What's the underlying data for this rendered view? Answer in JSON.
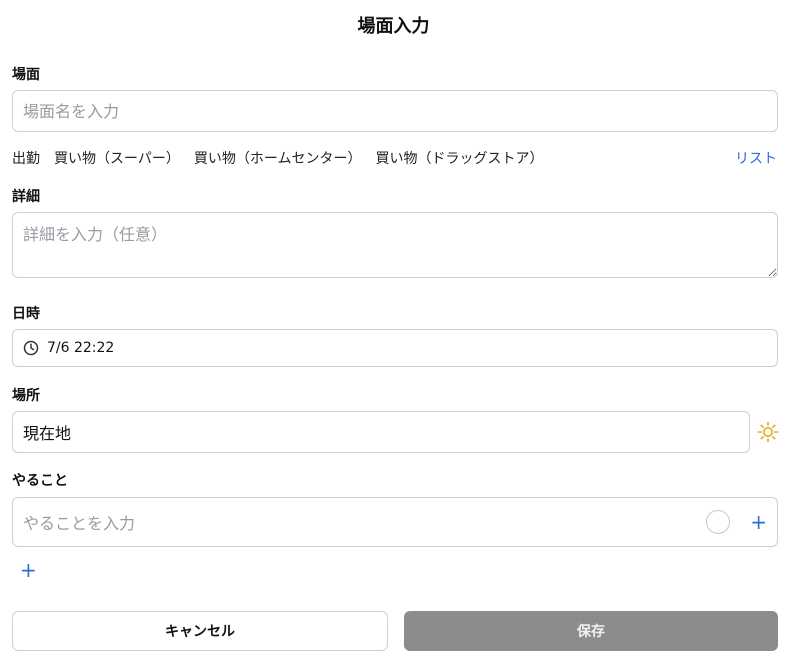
{
  "header": {
    "title": "場面入力"
  },
  "scene": {
    "label": "場面",
    "placeholder": "場面名を入力",
    "presets": [
      "出勤",
      "買い物（スーパー）",
      "買い物（ホームセンター）",
      "買い物（ドラッグストア）"
    ],
    "list_link": "リスト"
  },
  "details": {
    "label": "詳細",
    "placeholder": "詳細を入力（任意）"
  },
  "datetime": {
    "label": "日時",
    "value": "7/6 22:22"
  },
  "place": {
    "label": "場所",
    "value": "現在地"
  },
  "todo": {
    "label": "やること",
    "placeholder": "やることを入力",
    "add_symbol": "+"
  },
  "actions": {
    "cancel_label": "キャンセル",
    "save_label": "保存"
  },
  "colors": {
    "accent": "#2b6cd6",
    "sun": "#e0a91c",
    "save_bg": "#8c8c8c"
  },
  "icons": {
    "clock": "clock-icon",
    "sun": "sun-icon",
    "circle": "circle-icon",
    "plus": "plus-icon"
  }
}
